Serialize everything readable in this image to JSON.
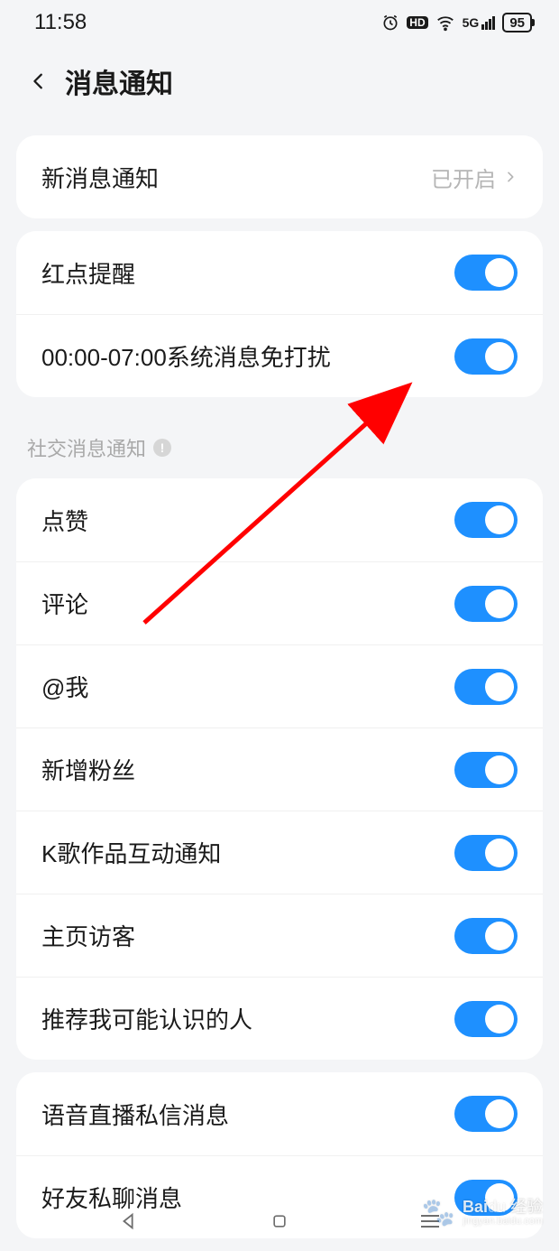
{
  "status": {
    "time": "11:58",
    "battery": "95",
    "network_label": "5G"
  },
  "header": {
    "title": "消息通知"
  },
  "group1": {
    "new_msg": {
      "label": "新消息通知",
      "value": "已开启"
    }
  },
  "group2": {
    "red_dot": {
      "label": "红点提醒",
      "on": true
    },
    "dnd": {
      "label": "00:00-07:00系统消息免打扰",
      "on": true
    }
  },
  "social_section_title": "社交消息通知",
  "social": [
    {
      "key": "like",
      "label": "点赞",
      "on": true
    },
    {
      "key": "comment",
      "label": "评论",
      "on": true
    },
    {
      "key": "at_me",
      "label": "@我",
      "on": true
    },
    {
      "key": "new_fans",
      "label": "新增粉丝",
      "on": true
    },
    {
      "key": "ksong",
      "label": "K歌作品互动通知",
      "on": true
    },
    {
      "key": "visitors",
      "label": "主页访客",
      "on": true
    },
    {
      "key": "suggest",
      "label": "推荐我可能认识的人",
      "on": true
    }
  ],
  "group3": [
    {
      "key": "voice_dm",
      "label": "语音直播私信消息",
      "on": true
    },
    {
      "key": "friend_chat",
      "label": "好友私聊消息",
      "on": true
    }
  ],
  "watermark": {
    "brand": "Bai",
    "brand2": "经验",
    "sub": "jingyan.baidu.com"
  }
}
